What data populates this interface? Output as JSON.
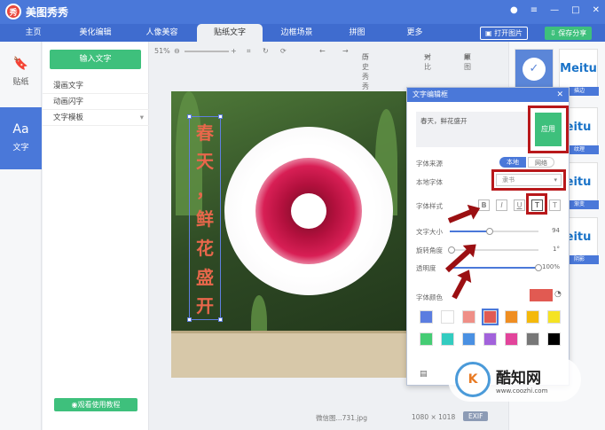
{
  "app": {
    "title": "美图秀秀"
  },
  "window_buttons": [
    "●",
    "≡",
    "—",
    "□",
    "✕"
  ],
  "tabs": [
    {
      "label": "主页"
    },
    {
      "label": "美化编辑"
    },
    {
      "label": "人像美容"
    },
    {
      "label": "贴纸文字"
    },
    {
      "label": "边框场景"
    },
    {
      "label": "拼图"
    },
    {
      "label": "更多"
    }
  ],
  "header_buttons": {
    "open": "打开图片",
    "save": "保存分享"
  },
  "left_nav": [
    {
      "label": "贴纸",
      "icon": "bookmark-icon"
    },
    {
      "label": "文字",
      "icon": "text-icon",
      "icon_text": "Aa"
    }
  ],
  "panel": {
    "input_button": "输入文字",
    "items": [
      "漫画文字",
      "动画闪字",
      "文字模板"
    ],
    "tutorial_button": "观看使用教程"
  },
  "toolbar": {
    "zoom": "51%",
    "history": "历史秀秀",
    "compare": "对比",
    "original": "原图"
  },
  "canvas_text": [
    "春",
    "天",
    "，",
    "鲜",
    "花",
    "盛",
    "开"
  ],
  "status": {
    "filename": "微信图...731.jpg",
    "size": "1080 × 1018",
    "exif": "EXIF"
  },
  "right_panel": {
    "thumbs": [
      {
        "text": "Meitu",
        "cap": "描边"
      },
      {
        "text": "eitu",
        "cap": "纹理"
      },
      {
        "text": "eitu",
        "cap": "渐变"
      },
      {
        "text": "eitu",
        "cap": "阴影"
      }
    ]
  },
  "dialog": {
    "title": "文字编辑框",
    "text_value": "春天，鲜花盛开",
    "apply": "应用",
    "source_label": "字体来源",
    "source_local": "本地",
    "source_web": "网络",
    "font_label": "本地字体",
    "font_value": "隶书",
    "style_label": "字体样式",
    "style_icons": [
      "B",
      "I",
      "U",
      "T",
      "T"
    ],
    "size_label": "文字大小",
    "size_value": "94",
    "rotate_label": "旋转角度",
    "rotate_value": "1°",
    "opacity_label": "透明度",
    "opacity_value": "100%",
    "color_label": "字体颜色",
    "current_color": "#e15a52",
    "swatches": [
      "#5b7de0",
      "#ffffff",
      "#ef8f87",
      "#e15a52",
      "#ef8e22",
      "#f4b90c",
      "#f5e323",
      "#45cc74",
      "#33ccc0",
      "#4a90e2",
      "#a262db",
      "#e2449b",
      "#777777",
      "#000000"
    ],
    "size_level": 0.45,
    "rotate_level": 0.02,
    "opacity_level": 1.0
  },
  "watermark": {
    "name": "酷知网",
    "url": "www.coozhi.com"
  }
}
